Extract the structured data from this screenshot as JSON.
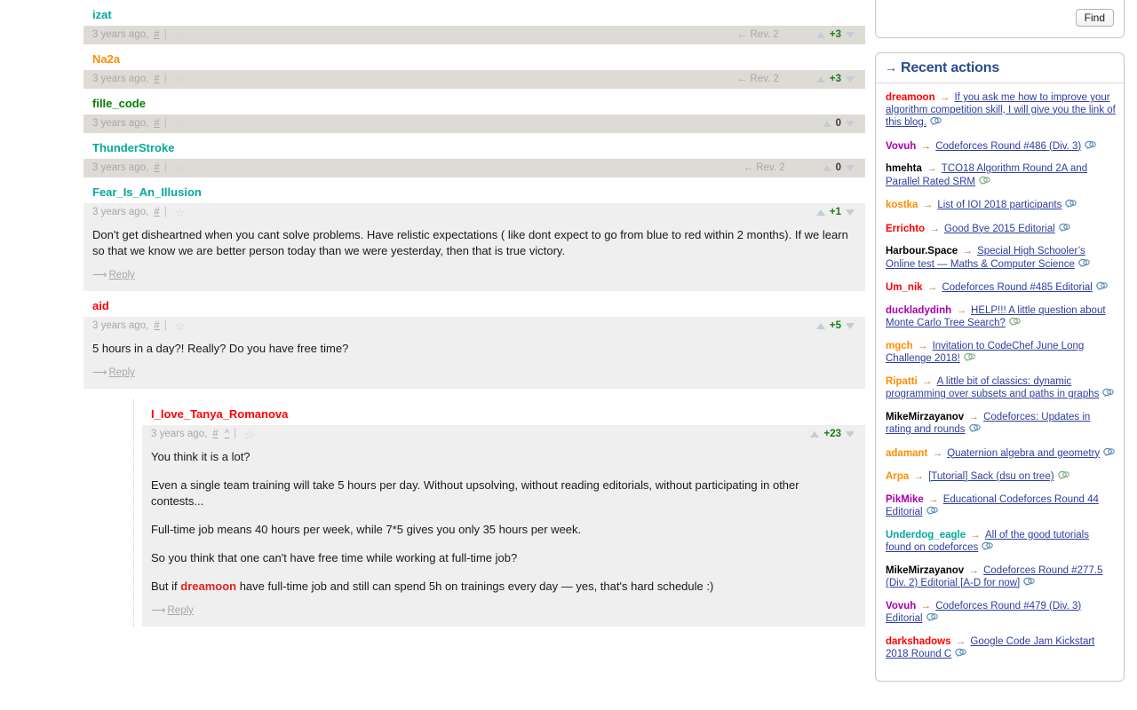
{
  "colors": {
    "red": "#ff0000",
    "orange": "#ff8c00",
    "violet": "#aa00aa",
    "blue": "#0000ff",
    "cyan": "#03a89e",
    "green": "#008000",
    "gray": "#808080",
    "score_positive": "#157d17",
    "link": "#2d3e9e",
    "header": "#2a4b8d"
  },
  "main": {
    "comments": [
      {
        "author": "izat",
        "author_color_class": "u-cyan",
        "time": "3 years ago,",
        "hash": "#",
        "sep": "|",
        "star": "☆",
        "rev": "← Rev. 2",
        "score": "+3",
        "score_class": "pos",
        "text": [],
        "reply": "",
        "row_bg": "alt"
      },
      {
        "author": "Na2a",
        "author_color_class": "u-orange",
        "time": "3 years ago,",
        "hash": "#",
        "sep": "|",
        "star": "☆",
        "rev": "← Rev. 2",
        "score": "+3",
        "score_class": "pos",
        "text": [],
        "reply": "",
        "row_bg": "alt"
      },
      {
        "author": "fille_code",
        "author_color_class": "u-green",
        "time": "3 years ago,",
        "hash": "#",
        "sep": "|",
        "star": "☆",
        "rev": "",
        "score": "0",
        "score_class": "zero",
        "text": [],
        "reply": "",
        "row_bg": "alt"
      },
      {
        "author": "ThunderStroke",
        "author_color_class": "u-cyan",
        "time": "3 years ago,",
        "hash": "#",
        "sep": "|",
        "star": "☆",
        "rev": "← Rev. 2",
        "score": "0",
        "score_class": "zero",
        "text": [],
        "reply": "",
        "row_bg": "alt"
      },
      {
        "author": "Fear_Is_An_Illusion",
        "author_color_class": "u-cyan",
        "time": "3 years ago,",
        "hash": "#",
        "sep": "|",
        "star": "☆",
        "rev": "",
        "score": "+1",
        "score_class": "pos",
        "text": [
          "Don't get disheartned when you cant solve problems. Have relistic expectations ( like dont expect to go from blue to red within 2 months). If we learn so that we know we are better person today than we were yesterday, then that is true victory."
        ],
        "reply": "Reply",
        "row_bg": "light"
      },
      {
        "author": "aid",
        "author_color_class": "u-red",
        "time": "3 years ago,",
        "hash": "#",
        "sep": "|",
        "star": "☆",
        "rev": "",
        "score": "+5",
        "score_class": "pos",
        "text": [
          "5 hours in a day?! Really? Do you have free time?"
        ],
        "reply": "Reply",
        "row_bg": "light"
      }
    ],
    "nested_comment": {
      "author": "I_love_Tanya_Romanova",
      "author_color_class": "u-red",
      "time": "3 years ago,",
      "hash": "#",
      "caret": "^",
      "sep": "|",
      "star": "☆",
      "score": "+23",
      "score_class": "pos",
      "paragraphs": [
        "You think it is a lot?",
        "Even a single team training will take 5 hours per day. Without upsolving, without reading editorials, without participating in other contests...",
        "Full-time job means 40 hours per week, while 7*5 gives you only 35 hours per week.",
        "So you think that one can't have free time while working at full-time job?"
      ],
      "last_paragraph": {
        "before": "But if ",
        "mention": "dreamoon",
        "after": " have full-time job and still can spend 5h on trainings every day — yes, that's hard schedule :)"
      },
      "reply": "Reply"
    }
  },
  "sidebar": {
    "find": {
      "button_label": "Find"
    },
    "recent_actions": {
      "arrow": "→",
      "title": "Recent actions",
      "items": [
        {
          "user": "dreamoon",
          "user_color_class": "u-red",
          "arrow": "→",
          "link": "If you ask me how to improve your algorithm competition skill, I will give you the link of this blog.",
          "icon": "comment-bubble-blue"
        },
        {
          "user": "Vovuh",
          "user_color_class": "u-violet",
          "arrow": "→",
          "link": "Codeforces Round #486 (Div. 3)",
          "icon": "comment-bubble-blue"
        },
        {
          "user": "hmehta",
          "user_color_class": "u-black",
          "arrow": "→",
          "link": "TCO18 Algorithm Round 2A and Parallel Rated SRM",
          "icon": "comment-bubble-green"
        },
        {
          "user": "kostka",
          "user_color_class": "u-orange",
          "arrow": "→",
          "link": "List of IOI 2018 participants",
          "icon": "comment-bubble-blue"
        },
        {
          "user": "Errichto",
          "user_color_class": "u-red",
          "arrow": "→",
          "link": "Good Bye 2015 Editorial",
          "icon": "comment-bubble-blue"
        },
        {
          "user": "Harbour.Space",
          "user_color_class": "u-black",
          "arrow": "→",
          "link": "Special High Schooler’s Online test — Maths & Computer Science",
          "icon": "comment-bubble-blue"
        },
        {
          "user": "Um_nik",
          "user_color_class": "u-red",
          "arrow": "→",
          "link": "Codeforces Round #485 Editorial",
          "icon": "comment-bubble-blue"
        },
        {
          "user": "duckladydinh",
          "user_color_class": "u-violet",
          "arrow": "→",
          "link": "HELP!!! A little question about Monte Carlo Tree Search?",
          "icon": "comment-bubble-green"
        },
        {
          "user": "mgch",
          "user_color_class": "u-orange",
          "arrow": "→",
          "link": "Invitation to CodeChef June Long Challenge 2018!",
          "icon": "comment-bubble-green"
        },
        {
          "user": "Ripatti",
          "user_color_class": "u-orange",
          "arrow": "→",
          "link": "A little bit of classics: dynamic programming over subsets and paths in graphs",
          "icon": "comment-bubble-blue"
        },
        {
          "user": "MikeMirzayanov",
          "user_color_class": "u-black",
          "arrow": "→",
          "link": "Codeforces: Updates in rating and rounds",
          "icon": "comment-bubble-blue"
        },
        {
          "user": "adamant",
          "user_color_class": "u-orange",
          "arrow": "→",
          "link": "Quaternion algebra and geometry",
          "icon": "comment-bubble-blue"
        },
        {
          "user": "Arpa",
          "user_color_class": "u-orange",
          "arrow": "→",
          "link": "[Tutorial] Sack (dsu on tree)",
          "icon": "comment-bubble-green"
        },
        {
          "user": "PikMike",
          "user_color_class": "u-violet",
          "arrow": "→",
          "link": "Educational Codeforces Round 44 Editorial",
          "icon": "comment-bubble-blue"
        },
        {
          "user": "Underdog_eagle",
          "user_color_class": "u-cyan",
          "arrow": "→",
          "link": "All of the good tutorials found on codeforces",
          "icon": "comment-bubble-blue"
        },
        {
          "user": "MikeMirzayanov",
          "user_color_class": "u-black",
          "arrow": "→",
          "link": "Codeforces Round #277.5 (Div. 2) Editorial [A-D for now]",
          "icon": "comment-bubble-blue"
        },
        {
          "user": "Vovuh",
          "user_color_class": "u-violet",
          "arrow": "→",
          "link": "Codeforces Round #479 (Div. 3) Editorial",
          "icon": "comment-bubble-blue"
        },
        {
          "user": "darkshadows",
          "user_color_class": "u-red",
          "arrow": "→",
          "link": "Google Code Jam Kickstart 2018 Round C",
          "icon": "comment-bubble-blue"
        }
      ]
    }
  }
}
